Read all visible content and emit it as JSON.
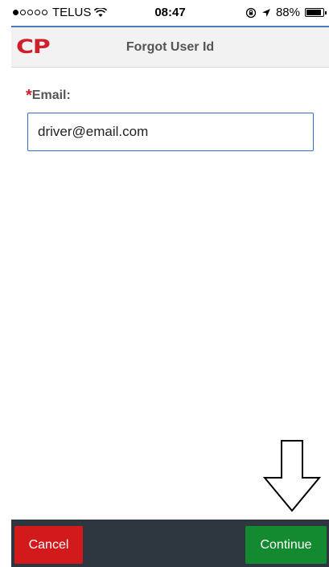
{
  "status_bar": {
    "carrier": "TELUS",
    "time": "08:47",
    "battery_percent": "88%",
    "battery_level": 0.88
  },
  "header": {
    "logo_text": "CP",
    "title": "Forgot User Id"
  },
  "form": {
    "email_label": "Email:",
    "required_marker": "*",
    "email_value": "driver@email.com"
  },
  "footer": {
    "cancel_label": "Cancel",
    "continue_label": "Continue"
  },
  "colors": {
    "brand_red": "#cf1f2a",
    "continue_green": "#138a2f",
    "cancel_red": "#d2191b",
    "input_border": "#2f70c8"
  }
}
